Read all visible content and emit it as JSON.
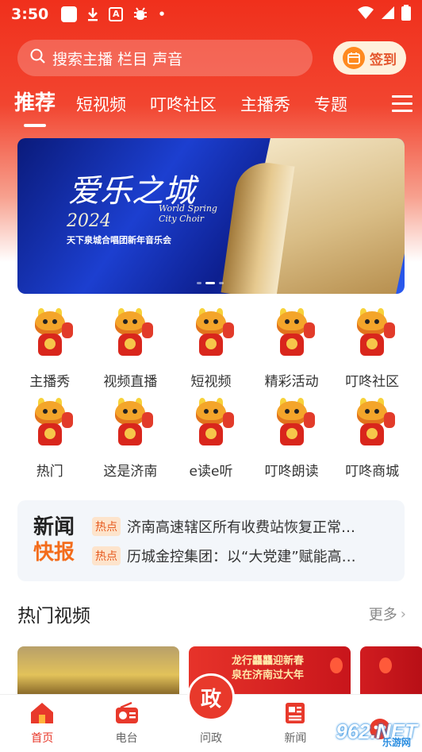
{
  "status_bar": {
    "time": "3:50",
    "dot": "•"
  },
  "search": {
    "placeholder": "搜索主播 栏目 声音",
    "signin_label": "签到"
  },
  "tabs": [
    {
      "label": "推荐",
      "active": true
    },
    {
      "label": "短视频"
    },
    {
      "label": "叮咚社区"
    },
    {
      "label": "主播秀"
    },
    {
      "label": "专题"
    }
  ],
  "banner": {
    "title": "爱乐之城",
    "subtitle_en_1": "World Spring",
    "subtitle_en_2": "City Choir",
    "year": "2024",
    "concert": "天下泉城合唱团新年音乐会"
  },
  "grid": [
    {
      "label": "主播秀"
    },
    {
      "label": "视频直播"
    },
    {
      "label": "短视频"
    },
    {
      "label": "精彩活动"
    },
    {
      "label": "叮咚社区"
    },
    {
      "label": "热门"
    },
    {
      "label": "这是济南"
    },
    {
      "label": "e读e听"
    },
    {
      "label": "叮咚朗读"
    },
    {
      "label": "叮咚商城"
    }
  ],
  "news": {
    "brand_line1": "新闻",
    "brand_line2": "快报",
    "items": [
      {
        "tag": "热点",
        "headline": "济南高速辖区所有收费站恢复正常…"
      },
      {
        "tag": "热点",
        "headline": "历城金控集团：以“大党建”赋能高…"
      }
    ]
  },
  "hot_videos": {
    "title": "热门视频",
    "more": "更多",
    "cards": [
      {
        "text": ""
      },
      {
        "text_1": "龙行龘龘迎新春",
        "text_2": "泉在济南过大年"
      },
      {
        "text": ""
      }
    ]
  },
  "bottom_nav": [
    {
      "label": "首页",
      "active": true
    },
    {
      "label": "电台"
    },
    {
      "label": "问政"
    },
    {
      "label": "新闻"
    },
    {
      "label": ""
    }
  ],
  "center_button_glyph": "政",
  "watermark": {
    "logo": "962.NET",
    "sub": "乐游网"
  },
  "colors": {
    "brand_red": "#e8392b",
    "accent_orange": "#f36c1b",
    "signin_bg": "#fff1dc"
  }
}
